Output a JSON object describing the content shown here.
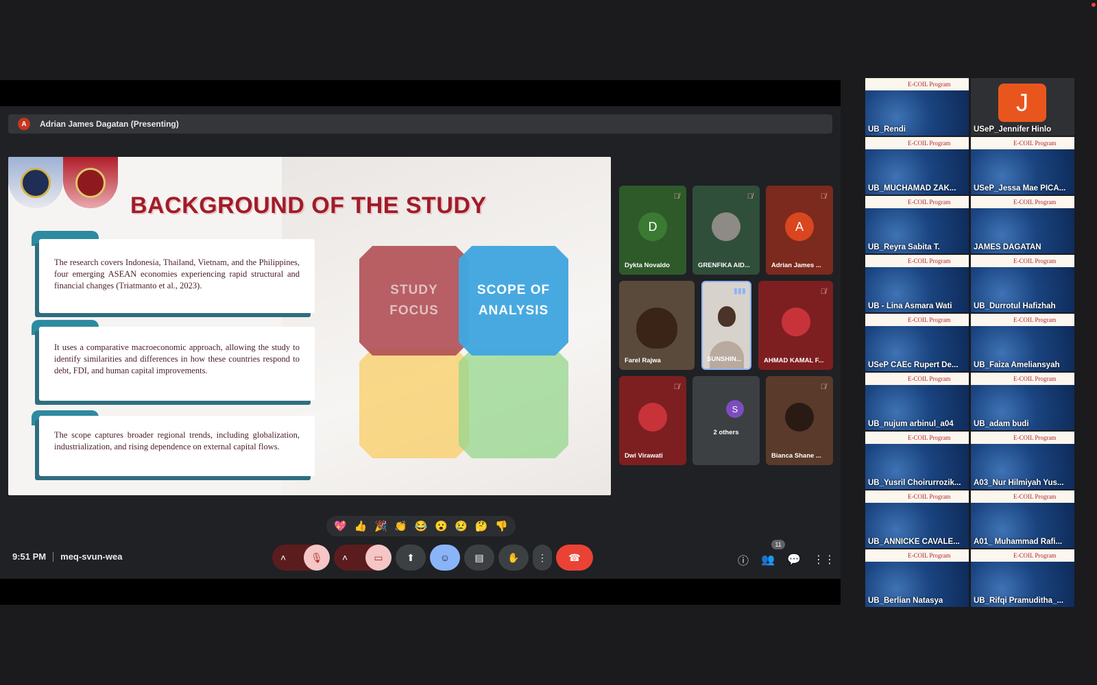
{
  "presenter": {
    "initial": "A",
    "label": "Adrian James Dagatan (Presenting)"
  },
  "slide": {
    "title": "BACKGROUND OF THE STUDY",
    "cards": [
      "The research covers Indonesia, Thailand, Vietnam, and the Philippines, four emerging ASEAN economies experiencing rapid structural and financial changes (Triatmanto et al., 2023).",
      "It uses a comparative macroeconomic approach, allowing the study to identify similarities and differences in how these countries respond to debt, FDI, and human capital improvements.",
      "The scope captures broader regional trends, including globalization, industrialization, and rising dependence on external capital flows."
    ],
    "diagram": {
      "study_focus": "STUDY FOCUS",
      "scope": "SCOPE OF ANALYSIS"
    }
  },
  "participants": [
    {
      "name": "Dykta Novaldo",
      "initial": "D",
      "muted": true
    },
    {
      "name": "GRENFIKA AID...",
      "muted": true
    },
    {
      "name": "Adrian James ...",
      "initial": "A",
      "muted": true
    },
    {
      "name": "Farel Rajwa"
    },
    {
      "name": "SUNSHIN..."
    },
    {
      "name": "AHMAD KAMAL F...",
      "muted": true
    },
    {
      "name": "Dwi Virawati",
      "muted": true
    },
    {
      "name": "2 others",
      "initial": "S"
    },
    {
      "name": "Bianca Shane ...",
      "muted": true
    }
  ],
  "reactions": [
    "💖",
    "👍",
    "🎉",
    "👏",
    "😂",
    "😮",
    "😢",
    "🤔",
    "👎"
  ],
  "meeting": {
    "time": "9:51 PM",
    "code": "meq-svun-wea",
    "people_count": "11"
  },
  "gallery": {
    "banner": "E-COIL Program",
    "tiles": [
      "UB_Rendi",
      "USeP_Jennifer Hinlo",
      "UB_MUCHAMAD ZAK...",
      "USeP_Jessa Mae PICA...",
      "UB_Reyra Sabita T.",
      "JAMES DAGATAN",
      "UB - Lina Asmara Wati",
      "UB_Durrotul Hafizhah",
      "USeP CAEc Rupert De...",
      "UB_Faiza Ameliansyah",
      "UB_nujum arbinul_a04",
      "UB_adam budi",
      "UB_Yusril Choirurrozik...",
      "A03_Nur Hilmiyah Yus...",
      "UB_ANNICKE CAVALE...",
      "A01_ Muhammad Rafi...",
      "UB_Berlian Natasya",
      "UB_Rifqi Pramuditha_..."
    ],
    "jennifer_initial": "J"
  }
}
